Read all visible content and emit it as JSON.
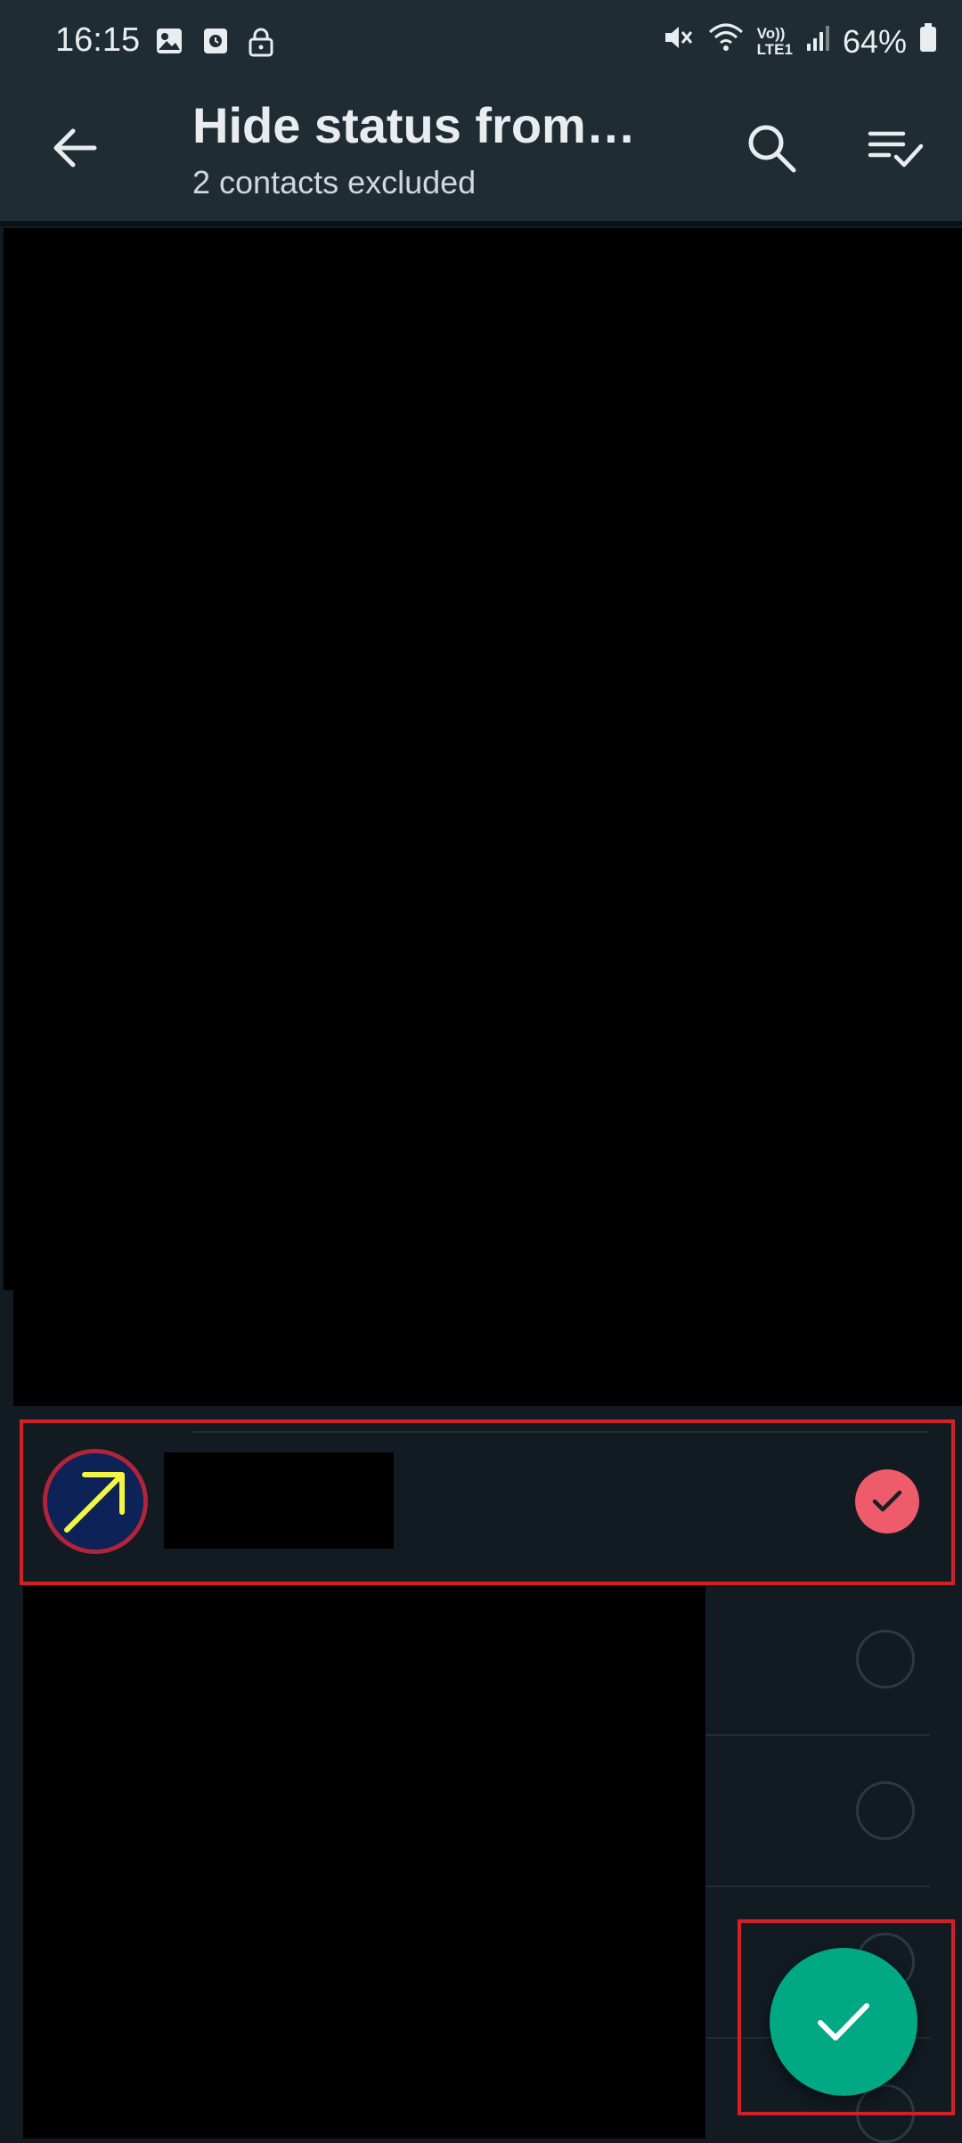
{
  "status_bar": {
    "time": "16:15",
    "battery": "64%",
    "left_icons": [
      "gallery-icon",
      "screen-record-icon",
      "lock-icon"
    ],
    "right_icons": [
      "mute-icon",
      "wifi-icon",
      "volte-icon",
      "signal-icon",
      "battery-icon"
    ],
    "volte_label": "Vo))",
    "lte_label": "LTE1"
  },
  "app_bar": {
    "title": "Hide status from…",
    "subtitle": "2 contacts excluded",
    "actions": [
      "search-icon",
      "select-all-icon"
    ]
  },
  "contacts": [
    {
      "name_redacted": true,
      "selected": true,
      "avatar": "arrow-avatar"
    },
    {
      "name_redacted": true,
      "selected": false
    },
    {
      "name_redacted": true,
      "selected": false
    },
    {
      "name_redacted": true,
      "selected": false
    },
    {
      "name_redacted": true,
      "selected": false
    }
  ],
  "fab": {
    "icon": "check-icon"
  },
  "colors": {
    "bar_bg": "#1f2c34",
    "page_bg": "#121b22",
    "accent": "#00a884",
    "selected_check": "#ee5b6b",
    "highlight": "#d32027"
  }
}
